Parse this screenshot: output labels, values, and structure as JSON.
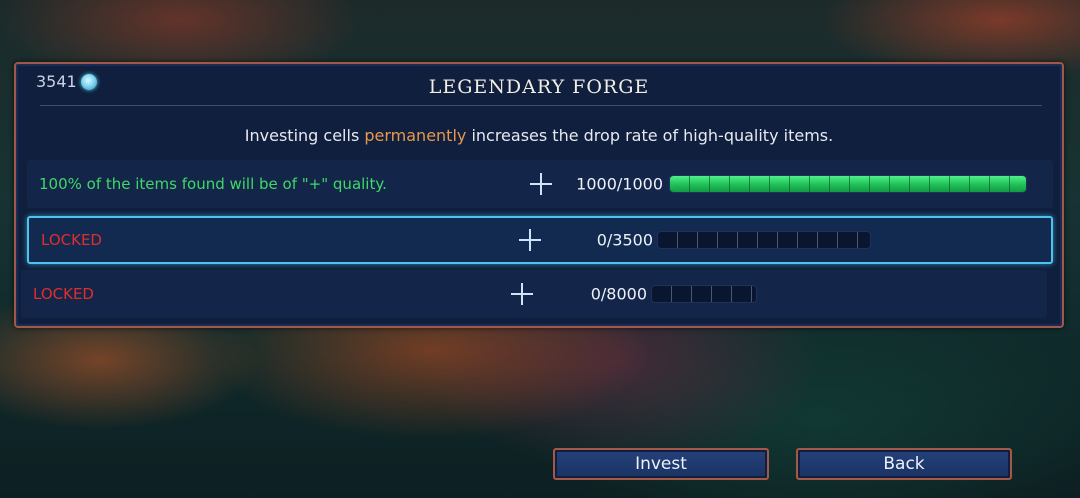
{
  "currency": {
    "value": "3541",
    "icon": "cell-icon"
  },
  "title": "LEGENDARY FORGE",
  "description": {
    "before": "Investing cells ",
    "highlight": "permanently",
    "after": " increases the drop rate of high-quality items."
  },
  "tiers": [
    {
      "label": "100% of the items found will be of \"+\" quality.",
      "status": "unlocked",
      "count": "1000/1000",
      "invested": 1000,
      "required": 1000
    },
    {
      "label": "LOCKED",
      "status": "locked",
      "count": "0/3500",
      "invested": 0,
      "required": 3500
    },
    {
      "label": "LOCKED",
      "status": "locked",
      "count": "0/8000",
      "invested": 0,
      "required": 8000
    }
  ],
  "buttons": {
    "invest": "Invest",
    "back": "Back"
  },
  "colors": {
    "accent_border": "#a0584c",
    "selected_border": "#4cc4ef",
    "unlocked_text": "#3ed867",
    "locked_text": "#e12d2d",
    "highlight_text": "#e8984d"
  }
}
